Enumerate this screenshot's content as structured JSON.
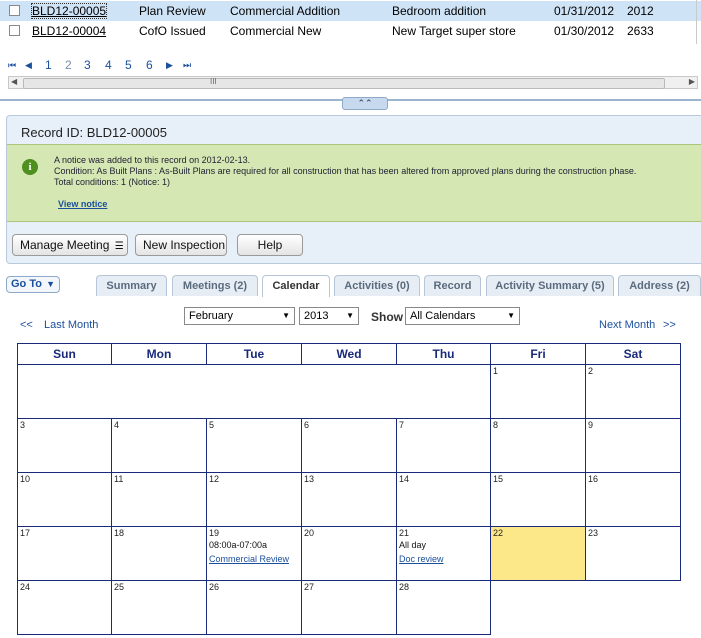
{
  "results": [
    {
      "id": "BLD12-00005",
      "status": "Plan Review",
      "type": "Commercial Addition",
      "desc": "Bedroom addition",
      "date": "01/31/2012",
      "num": "2012"
    },
    {
      "id": "BLD12-00004",
      "status": "CofO Issued",
      "type": "Commercial New",
      "desc": "New Target super store",
      "date": "01/30/2012",
      "num": "2633"
    }
  ],
  "pager": {
    "first": "⏮",
    "prev": "◀",
    "pages": [
      "1",
      "2",
      "3",
      "4",
      "5",
      "6"
    ],
    "next": "▶",
    "last": "⏭"
  },
  "scroll": {
    "thumb": "III"
  },
  "record": {
    "title": "Record ID: BLD12-00005",
    "notice_lines": [
      "A notice was added to this record on 2012-02-13.",
      "Condition: As Built Plans : As-Built Plans are required for all construction that has been altered from approved plans during the construction phase.",
      "Total conditions: 1  (Notice: 1)"
    ],
    "view_notice": "View notice",
    "buttons": {
      "manage": "Manage Meeting",
      "new_inspection": "New Inspection",
      "help": "Help"
    }
  },
  "goto": "Go To",
  "tabs": [
    {
      "label": "Summary"
    },
    {
      "label": "Meetings (2)"
    },
    {
      "label": "Calendar"
    },
    {
      "label": "Activities (0)"
    },
    {
      "label": "Record"
    },
    {
      "label": "Activity Summary (5)"
    },
    {
      "label": "Address (2)"
    }
  ],
  "calendar": {
    "last_month": "Last Month",
    "last_arrows": "<<",
    "next_month": "Next Month",
    "next_arrows": ">>",
    "month": "February",
    "year": "2013",
    "show_label": "Show",
    "show_value": "All Calendars",
    "weekdays": [
      "Sun",
      "Mon",
      "Tue",
      "Wed",
      "Thu",
      "Fri",
      "Sat"
    ],
    "weeks": [
      [
        "",
        "",
        "",
        "",
        "",
        "1",
        "2"
      ],
      [
        "3",
        "4",
        "5",
        "6",
        "7",
        "8",
        "9"
      ],
      [
        "10",
        "11",
        "12",
        "13",
        "14",
        "15",
        "16"
      ],
      [
        "17",
        "18",
        "19",
        "20",
        "21",
        "22",
        "23"
      ],
      [
        "24",
        "25",
        "26",
        "27",
        "28",
        "",
        ""
      ]
    ],
    "events": {
      "19": {
        "time": "08:00a-07:00a",
        "link": "Commercial Review"
      },
      "21": {
        "time": "All day",
        "link": "Doc review"
      }
    },
    "today": "22"
  }
}
